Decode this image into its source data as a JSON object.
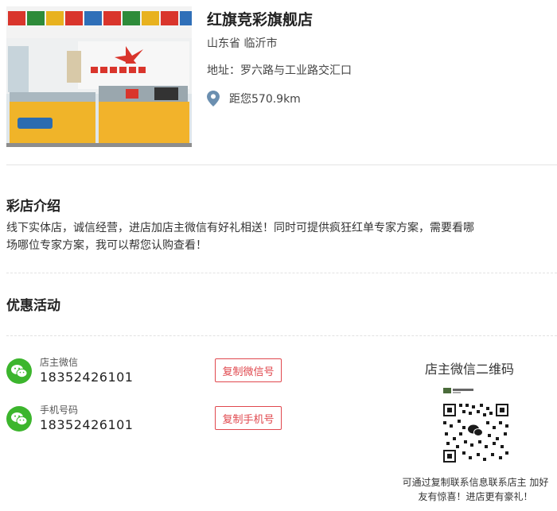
{
  "store": {
    "name": "红旗竞彩旗舰店",
    "region": "山东省 临沂市",
    "address": "地址：罗六路与工业路交汇口",
    "distance": "距您570.9km"
  },
  "intro": {
    "title": "彩店介绍",
    "text": "线下实体店，诚信经营，进店加店主微信有好礼相送！同时可提供疯狂红单专家方案，需要看哪场哪位专家方案，我可以帮您认购查看！"
  },
  "promotions": {
    "title": "优惠活动"
  },
  "contacts": {
    "wechat": {
      "label": "店主微信",
      "value": "18352426101",
      "copy_label": "复制微信号"
    },
    "phone": {
      "label": "手机号码",
      "value": "18352426101",
      "copy_label": "复制手机号"
    }
  },
  "qr": {
    "title": "店主微信二维码",
    "footer": "可通过复制联系信息联系店主 加好友有惊喜！进店更有豪礼！"
  },
  "colors": {
    "accent_red": "#e0484e",
    "wechat_green": "#3cb52d",
    "pin_blue": "#6b8fb0"
  },
  "icons": {
    "location": "map-pin-icon",
    "wechat": "wechat-icon"
  }
}
